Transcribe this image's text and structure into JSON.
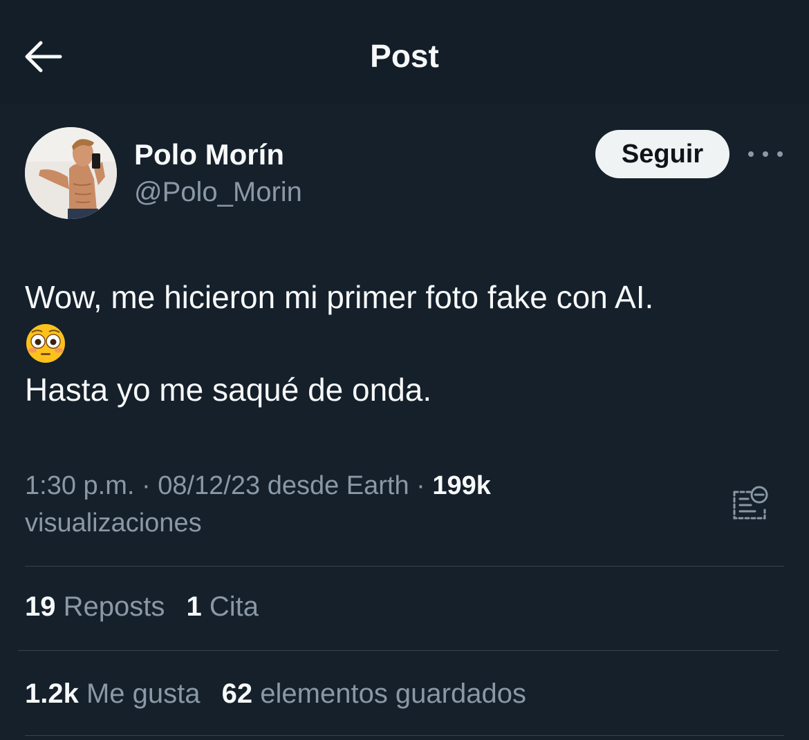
{
  "header": {
    "title": "Post",
    "back_icon": "arrow-left-icon"
  },
  "author": {
    "display_name": "Polo Morín",
    "handle": "@Polo_Morin",
    "follow_label": "Seguir",
    "more_icon": "more-horizontal-icon"
  },
  "tweet": {
    "line1": "Wow, me hicieron mi primer foto fake con AI.",
    "emoji": "flushed-face-emoji",
    "line2": "Hasta yo me saqué de onda."
  },
  "meta": {
    "time": "1:30 p.m.",
    "sep1": "·",
    "date": "08/12/23",
    "source": "desde Earth",
    "sep2": "·",
    "views": "199k",
    "views_label": "visualizaciones",
    "note_icon": "community-note-icon"
  },
  "stats": {
    "reposts_count": "19",
    "reposts_label": "Reposts",
    "quotes_count": "1",
    "quotes_label": "Cita",
    "likes_count": "1.2k",
    "likes_label": "Me gusta",
    "bookmarks_count": "62",
    "bookmarks_label": "elementos guardados"
  },
  "colors": {
    "background": "#15202b",
    "text_primary": "#f7f9f9",
    "text_secondary": "#8b98a5",
    "divider": "#38444d",
    "button_bg": "#eff3f4"
  }
}
